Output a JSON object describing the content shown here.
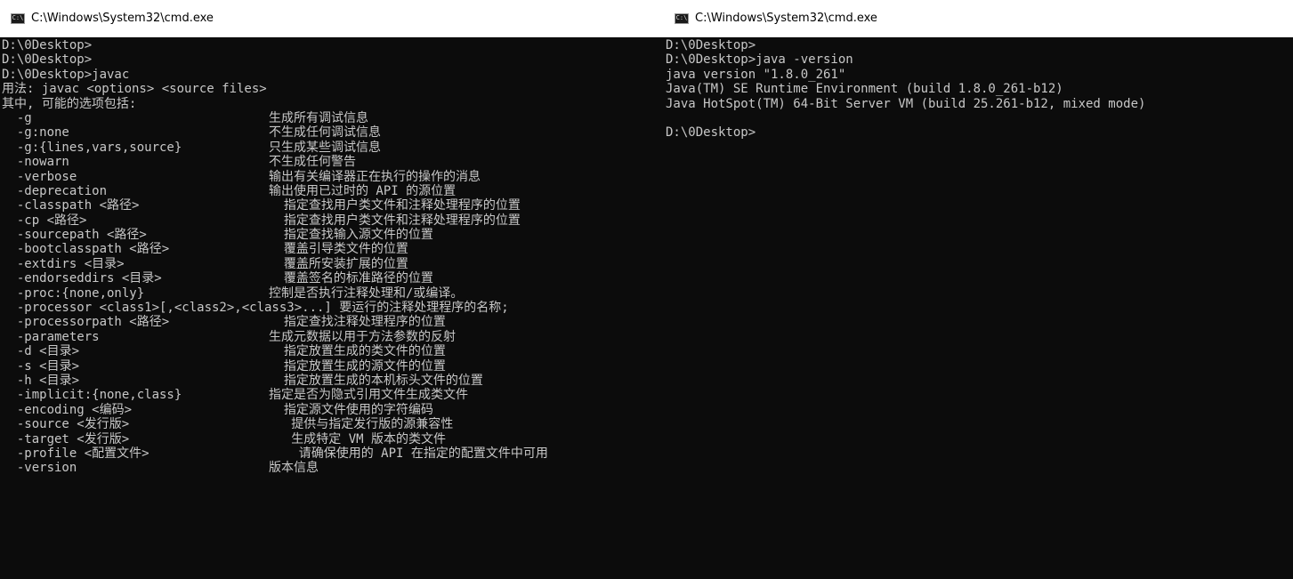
{
  "windows": [
    {
      "title": "C:\\Windows\\System32\\cmd.exe",
      "icon": "cmd-icon",
      "lines": [
        "D:\\0Desktop>",
        "D:\\0Desktop>",
        "D:\\0Desktop>javac",
        "用法: javac <options> <source files>",
        "其中, 可能的选项包括:"
      ],
      "options": [
        {
          "flag": "  -g",
          "desc": "生成所有调试信息"
        },
        {
          "flag": "  -g:none",
          "desc": "不生成任何调试信息"
        },
        {
          "flag": "  -g:{lines,vars,source}",
          "desc": "只生成某些调试信息"
        },
        {
          "flag": "  -nowarn",
          "desc": "不生成任何警告"
        },
        {
          "flag": "  -verbose",
          "desc": "输出有关编译器正在执行的操作的消息"
        },
        {
          "flag": "  -deprecation",
          "desc": "输出使用已过时的 API 的源位置"
        },
        {
          "flag": "  -classpath <路径>",
          "desc": "  指定查找用户类文件和注释处理程序的位置"
        },
        {
          "flag": "  -cp <路径>",
          "desc": "  指定查找用户类文件和注释处理程序的位置"
        },
        {
          "flag": "  -sourcepath <路径>",
          "desc": "  指定查找输入源文件的位置"
        },
        {
          "flag": "  -bootclasspath <路径>",
          "desc": "  覆盖引导类文件的位置"
        },
        {
          "flag": "  -extdirs <目录>",
          "desc": "  覆盖所安装扩展的位置"
        },
        {
          "flag": "  -endorseddirs <目录>",
          "desc": "  覆盖签名的标准路径的位置"
        },
        {
          "flag": "  -proc:{none,only}",
          "desc": "控制是否执行注释处理和/或编译。"
        },
        {
          "flag": "  -processor <class1>[,<class2>,<class3>...]",
          "desc": " 要运行的注释处理程序的名称;"
        },
        {
          "flag": "  -processorpath <路径>",
          "desc": "  指定查找注释处理程序的位置"
        },
        {
          "flag": "  -parameters",
          "desc": "生成元数据以用于方法参数的反射"
        },
        {
          "flag": "  -d <目录>",
          "desc": "  指定放置生成的类文件的位置"
        },
        {
          "flag": "  -s <目录>",
          "desc": "  指定放置生成的源文件的位置"
        },
        {
          "flag": "  -h <目录>",
          "desc": "  指定放置生成的本机标头文件的位置"
        },
        {
          "flag": "  -implicit:{none,class}",
          "desc": "指定是否为隐式引用文件生成类文件"
        },
        {
          "flag": "  -encoding <编码>",
          "desc": "  指定源文件使用的字符编码"
        },
        {
          "flag": "  -source <发行版>",
          "desc": "   提供与指定发行版的源兼容性"
        },
        {
          "flag": "  -target <发行版>",
          "desc": "   生成特定 VM 版本的类文件"
        },
        {
          "flag": "  -profile <配置文件>",
          "desc": "    请确保使用的 API 在指定的配置文件中可用"
        },
        {
          "flag": "  -version",
          "desc": "版本信息"
        }
      ]
    },
    {
      "title": "C:\\Windows\\System32\\cmd.exe",
      "icon": "cmd-icon",
      "lines": [
        "D:\\0Desktop>",
        "D:\\0Desktop>java -version",
        "java version \"1.8.0_261\"",
        "Java(TM) SE Runtime Environment (build 1.8.0_261-b12)",
        "Java HotSpot(TM) 64-Bit Server VM (build 25.261-b12, mixed mode)",
        "",
        "D:\\0Desktop>"
      ]
    }
  ],
  "colors": {
    "console_bg": "#0c0c0c",
    "console_fg": "#c8c8c8",
    "titlebar_bg": "#ffffff"
  }
}
